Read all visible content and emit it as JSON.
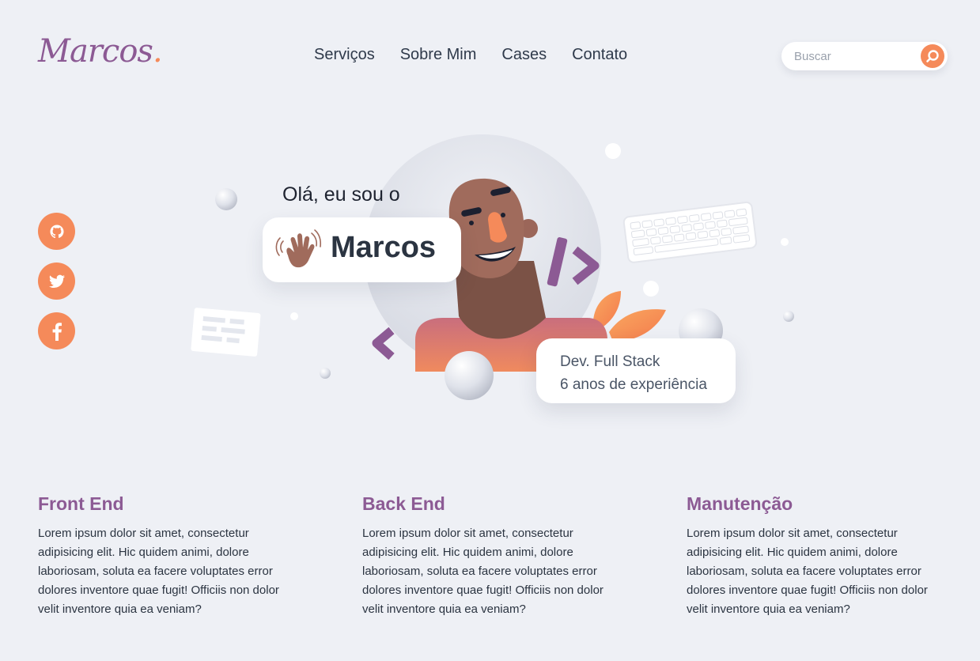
{
  "brand": {
    "name": "Marcos",
    "dot": ".",
    "accent": "#f58a5a",
    "purple": "#8c5a94"
  },
  "nav": {
    "items": [
      {
        "label": "Serviços"
      },
      {
        "label": "Sobre Mim"
      },
      {
        "label": "Cases"
      },
      {
        "label": "Contato"
      }
    ]
  },
  "search": {
    "placeholder": "Buscar",
    "icon": "search-icon"
  },
  "social": [
    {
      "icon": "github-icon"
    },
    {
      "icon": "twitter-icon"
    },
    {
      "icon": "facebook-icon"
    }
  ],
  "hero": {
    "greeting": "Olá, eu sou o",
    "name": "Marcos",
    "role": "Dev. Full Stack",
    "experience": "6 anos de experiência"
  },
  "services": [
    {
      "title": "Front End",
      "text": "Lorem ipsum dolor sit amet, consectetur adipisicing elit. Hic quidem animi, dolore laboriosam, soluta ea facere voluptates error dolores inventore quae fugit! Officiis non dolor velit inventore quia ea veniam?"
    },
    {
      "title": "Back End",
      "text": "Lorem ipsum dolor sit amet, consectetur adipisicing elit. Hic quidem animi, dolore laboriosam, soluta ea facere voluptates error dolores inventore quae fugit! Officiis non dolor velit inventore quia ea veniam?"
    },
    {
      "title": "Manutenção",
      "text": "Lorem ipsum dolor sit amet, consectetur adipisicing elit. Hic quidem animi, dolore laboriosam, soluta ea facere voluptates error dolores inventore quae fugit! Officiis non dolor velit inventore quia ea veniam?"
    }
  ]
}
